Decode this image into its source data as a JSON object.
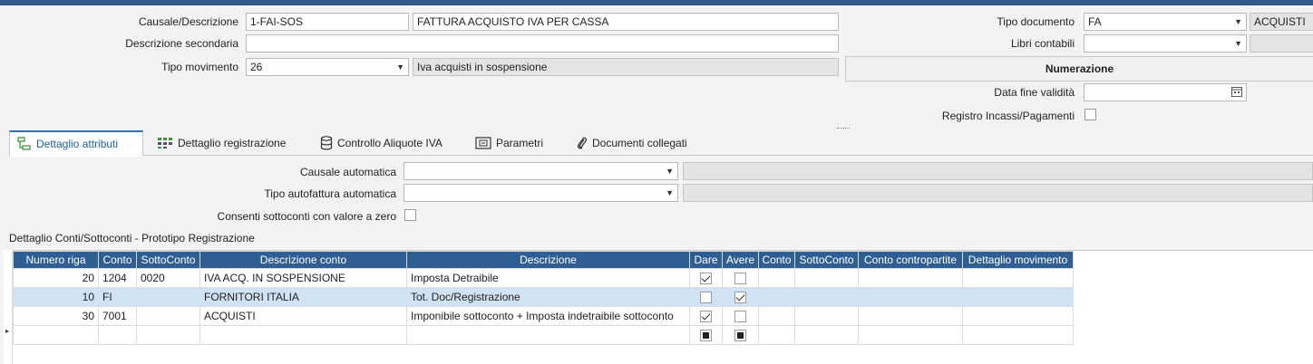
{
  "header": {
    "causale_label": "Causale/Descrizione",
    "causale_code": "1-FAI-SOS",
    "causale_desc": "FATTURA ACQUISTO IVA PER CASSA",
    "desc_sec_label": "Descrizione secondaria",
    "desc_sec_value": "",
    "tipo_mov_label": "Tipo movimento",
    "tipo_mov_value": "26",
    "tipo_mov_desc": "Iva acquisti in sospensione",
    "tipo_doc_label": "Tipo documento",
    "tipo_doc_value": "FA",
    "tipo_doc_desc": "ACQUISTI",
    "libri_label": "Libri contabili",
    "libri_value": "",
    "numerazione_label": "Numerazione",
    "data_fine_label": "Data fine validità",
    "data_fine_value": "",
    "registro_label": "Registro Incassi/Pagamenti"
  },
  "tabs": [
    {
      "label": "Dettaglio attributi",
      "icon": "attributes-icon",
      "active": true
    },
    {
      "label": "Dettaglio registrazione",
      "icon": "registration-grid-icon"
    },
    {
      "label": "Controllo Aliquote IVA",
      "icon": "database-icon"
    },
    {
      "label": "Parametri",
      "icon": "parameters-icon"
    },
    {
      "label": "Documenti collegati",
      "icon": "paperclip-icon"
    }
  ],
  "attributes": {
    "causale_auto_label": "Causale automatica",
    "causale_auto_value": "",
    "tipo_autofatt_label": "Tipo autofattura automatica",
    "tipo_autofatt_value": "",
    "consenti_label": "Consenti sottoconti con valore a zero"
  },
  "grid": {
    "title": "Dettaglio Conti/Sottoconti - Prototipo Registrazione",
    "columns": [
      "Numero riga",
      "Conto",
      "SottoConto",
      "Descrizione conto",
      "Descrizione",
      "Dare",
      "Avere",
      "Conto",
      "SottoConto",
      "Conto contropartite",
      "Dettaglio movimento"
    ],
    "rows": [
      {
        "riga": "20",
        "conto": "1204",
        "sottoconto": "0020",
        "desc_conto": "IVA ACQ. IN SOSPENSIONE",
        "descrizione": "Imposta Detraibile",
        "dare": true,
        "avere": false
      },
      {
        "riga": "10",
        "conto": "FI",
        "sottoconto": "",
        "desc_conto": "FORNITORI ITALIA",
        "descrizione": "Tot. Doc/Registrazione",
        "dare": false,
        "avere": true
      },
      {
        "riga": "30",
        "conto": "7001",
        "sottoconto": "",
        "desc_conto": "ACQUISTI",
        "descrizione": "Imponibile sottoconto + Imposta indetraibile sottoconto",
        "dare": true,
        "avere": false
      }
    ]
  },
  "colors": {
    "accent": "#2f5f92",
    "selection": "#cfe3f5"
  }
}
